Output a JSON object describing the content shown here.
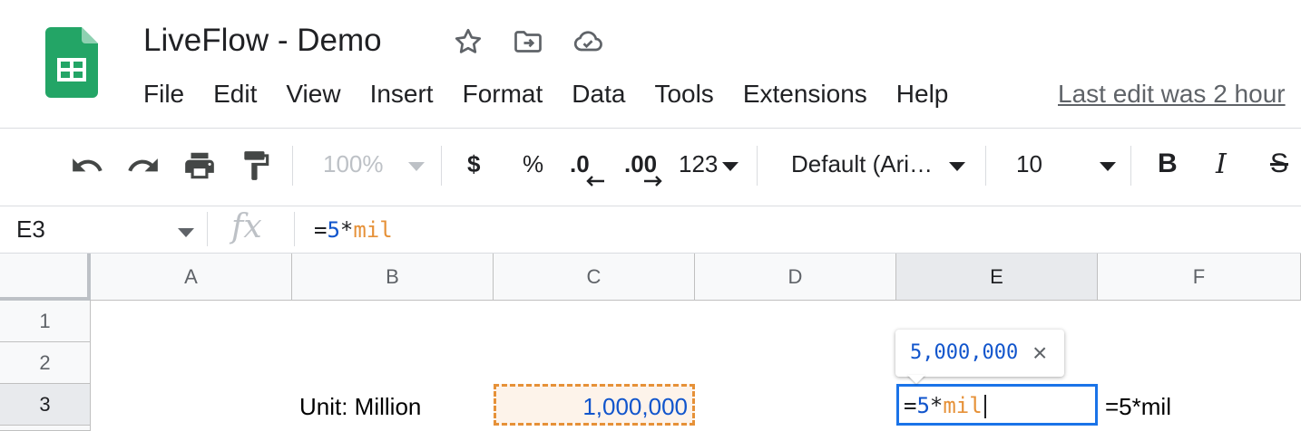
{
  "header": {
    "doc_title": "LiveFlow - Demo",
    "last_edit": "Last edit was 2 hour",
    "menu": [
      "File",
      "Edit",
      "View",
      "Insert",
      "Format",
      "Data",
      "Tools",
      "Extensions",
      "Help"
    ],
    "icons": [
      "sheets-logo-icon",
      "star-icon",
      "move-folder-icon",
      "cloud-saved-icon"
    ]
  },
  "toolbar": {
    "zoom": "100%",
    "currency": "$",
    "percent": "%",
    "decrease_decimal": ".0",
    "increase_decimal": ".00",
    "more_formats": "123",
    "font": "Default (Ari…",
    "font_size": "10",
    "bold": "B",
    "italic": "I",
    "strikethrough": "S",
    "icons": [
      "undo-icon",
      "redo-icon",
      "print-icon",
      "paint-format-icon"
    ]
  },
  "formula_bar": {
    "name_box": "E3",
    "fx": "fx",
    "formula": {
      "eq": "=",
      "num": "5",
      "op": "*",
      "ref": "mil"
    }
  },
  "grid": {
    "columns": [
      "A",
      "B",
      "C",
      "D",
      "E",
      "F"
    ],
    "rows": [
      "1",
      "2",
      "3"
    ],
    "active_column": "E",
    "active_row": "3",
    "cells": {
      "B3": "Unit: Million",
      "C3": "1,000,000",
      "F3": "=5*mil"
    }
  },
  "tooltip": {
    "value": "5,000,000",
    "close": "×"
  },
  "colors": {
    "accent": "#1a73e8",
    "range_highlight": "#e69138",
    "number_blue": "#1155cc",
    "sheets_green": "#0f9d58"
  }
}
